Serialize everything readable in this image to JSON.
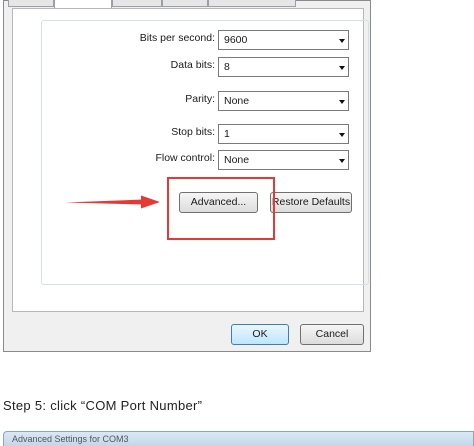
{
  "dialog": {
    "fields": [
      {
        "label": "Bits per second:",
        "value": "9600"
      },
      {
        "label": "Data bits:",
        "value": "8"
      },
      {
        "label": "Parity:",
        "value": "None"
      },
      {
        "label": "Stop bits:",
        "value": "1"
      },
      {
        "label": "Flow control:",
        "value": "None"
      }
    ],
    "advanced_label": "Advanced...",
    "restore_label": "Restore Defaults",
    "ok_label": "OK",
    "cancel_label": "Cancel"
  },
  "annotation": {
    "highlight_color": "#e53935",
    "arrow_color": "#e53935"
  },
  "instruction": {
    "text": "Step 5: click “COM Port Number”"
  },
  "window2": {
    "title": "Advanced Settings for COM3"
  }
}
